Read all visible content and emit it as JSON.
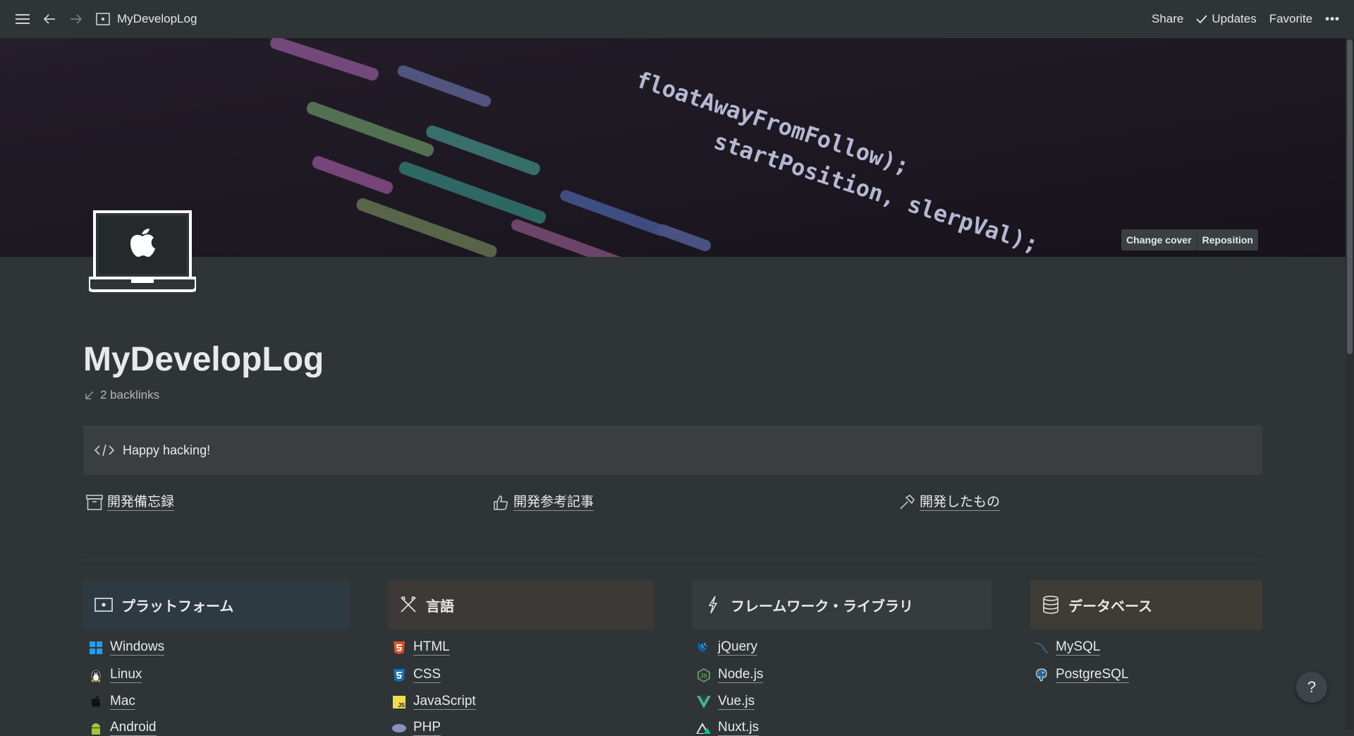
{
  "topbar": {
    "page_title": "MyDevelopLog",
    "share_label": "Share",
    "updates_label": "Updates",
    "favorite_label": "Favorite",
    "more_label": "•••"
  },
  "cover": {
    "code_line_1": "floatAwayFromFollow);",
    "code_line_2": "startPosition, slerpVal);",
    "change_cover_label": "Change cover",
    "reposition_label": "Reposition"
  },
  "page": {
    "title": "MyDevelopLog",
    "backlinks": "2 backlinks",
    "callout_text": "Happy hacking!"
  },
  "links": [
    {
      "label": "開発備忘録",
      "icon": "archive-icon"
    },
    {
      "label": "開発参考記事",
      "icon": "thumbs-up-icon"
    },
    {
      "label": "開発したもの",
      "icon": "hammer-icon"
    }
  ],
  "columns": [
    {
      "heading": "プラットフォーム",
      "icon": "monitor-icon",
      "bg": "#2d3a42",
      "items": [
        {
          "label": "Windows",
          "icon": "windows-icon"
        },
        {
          "label": "Linux",
          "icon": "linux-icon"
        },
        {
          "label": "Mac",
          "icon": "apple-icon"
        },
        {
          "label": "Android",
          "icon": "android-icon"
        }
      ]
    },
    {
      "heading": "言語",
      "icon": "tools-icon",
      "bg": "#3d3937",
      "items": [
        {
          "label": "HTML",
          "icon": "html5-icon"
        },
        {
          "label": "CSS",
          "icon": "css3-icon"
        },
        {
          "label": "JavaScript",
          "icon": "javascript-icon"
        },
        {
          "label": "PHP",
          "icon": "php-icon"
        }
      ]
    },
    {
      "heading": "フレームワーク・ライブラリ",
      "icon": "lightning-icon",
      "bg": "#363b3d",
      "items": [
        {
          "label": "jQuery",
          "icon": "jquery-icon"
        },
        {
          "label": "Node.js",
          "icon": "nodejs-icon"
        },
        {
          "label": "Vue.js",
          "icon": "vuejs-icon"
        },
        {
          "label": "Nuxt.js",
          "icon": "nuxtjs-icon"
        }
      ]
    },
    {
      "heading": "データベース",
      "icon": "database-icon",
      "bg": "#3d3c35",
      "items": [
        {
          "label": "MySQL",
          "icon": "mysql-icon"
        },
        {
          "label": "PostgreSQL",
          "icon": "postgresql-icon"
        }
      ]
    }
  ],
  "help_label": "?"
}
